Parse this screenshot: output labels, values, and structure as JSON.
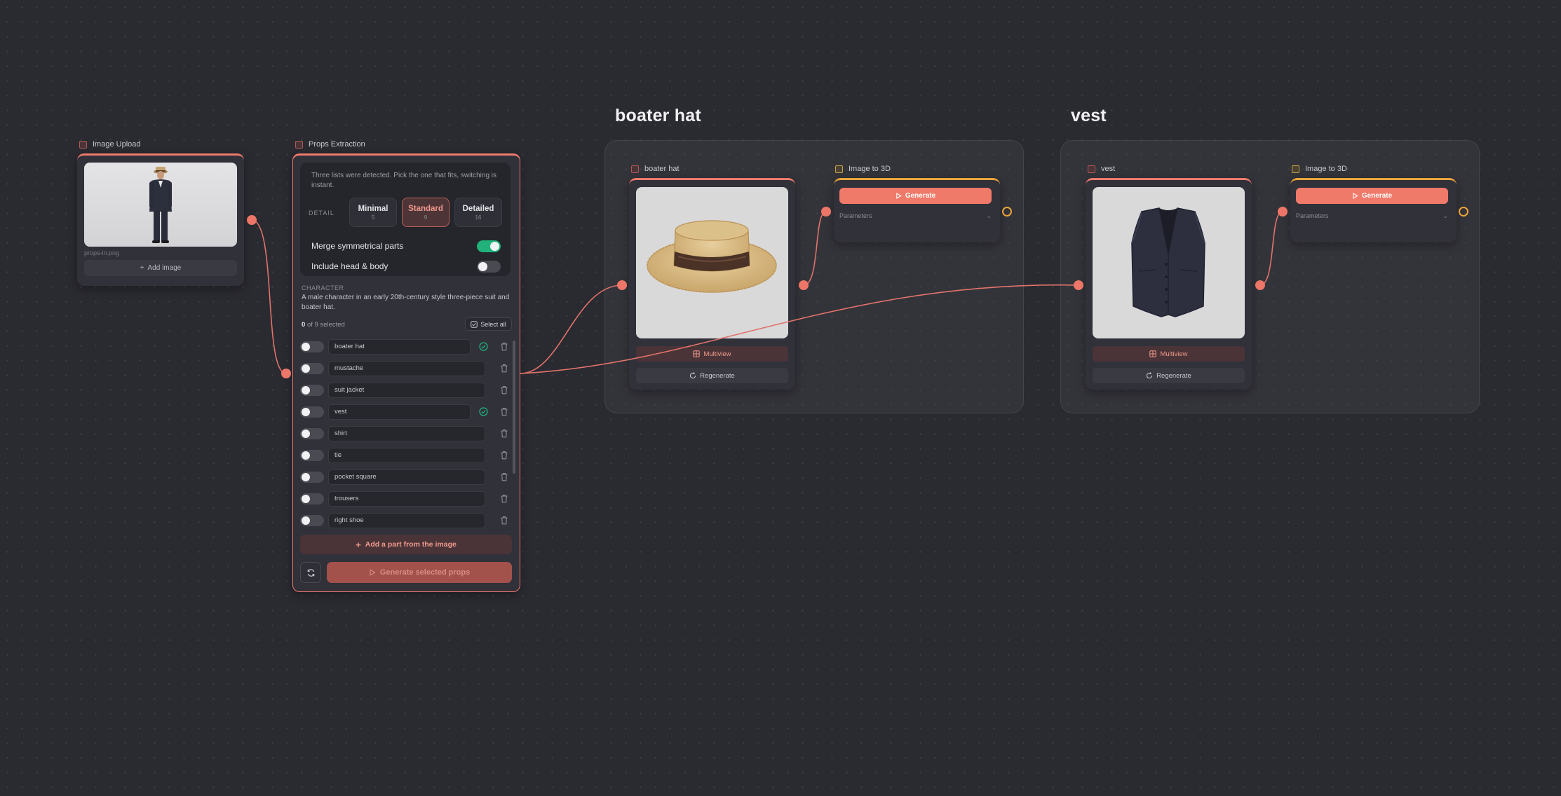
{
  "image_upload": {
    "title": "Image Upload",
    "filename": "props-in.png",
    "add_image_label": "Add image"
  },
  "props_extraction": {
    "title": "Props Extraction",
    "hint": "Three lists were detected. Pick the one that fits, switching is instant.",
    "detail_label": "DETAIL",
    "detail_options": [
      {
        "label": "Minimal",
        "count": "5",
        "active": false
      },
      {
        "label": "Standard",
        "count": "9",
        "active": true
      },
      {
        "label": "Detailed",
        "count": "16",
        "active": false
      }
    ],
    "merge_label": "Merge symmetrical parts",
    "merge_on": true,
    "include_label": "Include head & body",
    "include_on": false,
    "character_label": "CHARACTER",
    "character_desc": "A male character in an early 20th-century style three-piece suit and boater hat.",
    "selected_num": "0",
    "selected_rest": "of 9 selected",
    "select_all_label": "Select all",
    "parts": [
      {
        "name": "boater hat",
        "generated": true
      },
      {
        "name": "mustache",
        "generated": false
      },
      {
        "name": "suit jacket",
        "generated": false
      },
      {
        "name": "vest",
        "generated": true
      },
      {
        "name": "shirt",
        "generated": false
      },
      {
        "name": "tie",
        "generated": false
      },
      {
        "name": "pocket square",
        "generated": false
      },
      {
        "name": "trousers",
        "generated": false
      },
      {
        "name": "right shoe",
        "generated": false
      }
    ],
    "add_part_label": "Add a part from the image",
    "generate_label": "Generate selected props"
  },
  "groups": [
    {
      "title": "boater hat",
      "prop_node_title": "boater hat",
      "multiview_label": "Multiview",
      "regenerate_label": "Regenerate",
      "i3d_title": "Image to 3D",
      "generate_label": "Generate",
      "parameters_label": "Parameters"
    },
    {
      "title": "vest",
      "prop_node_title": "vest",
      "multiview_label": "Multiview",
      "regenerate_label": "Regenerate",
      "i3d_title": "Image to 3D",
      "generate_label": "Generate",
      "parameters_label": "Parameters"
    }
  ],
  "colors": {
    "accent": "#ef7b6c",
    "success": "#20b27a",
    "output_port": "#e9a43a",
    "background": "#2a2a31"
  }
}
